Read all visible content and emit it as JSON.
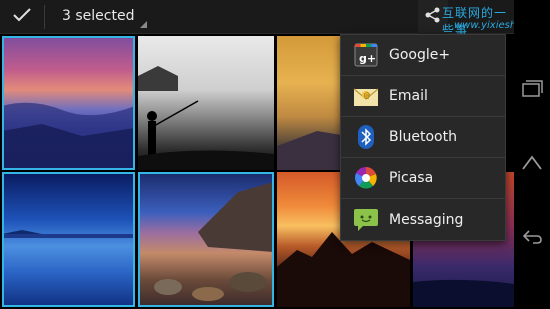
{
  "action_bar": {
    "selection_label": "3 selected",
    "done_icon": "checkmark-icon",
    "share_icon": "share-icon"
  },
  "watermark": {
    "site_name": "互联网的一些事",
    "url": "www.yixieshi.com"
  },
  "share_menu": {
    "items": [
      {
        "label": "Google+",
        "icon": "google-plus-icon"
      },
      {
        "label": "Email",
        "icon": "email-icon"
      },
      {
        "label": "Bluetooth",
        "icon": "bluetooth-icon"
      },
      {
        "label": "Picasa",
        "icon": "picasa-icon"
      },
      {
        "label": "Messaging",
        "icon": "messaging-icon"
      }
    ]
  },
  "gallery": {
    "photos": [
      {
        "subject": "purple sunset over rocky shore",
        "selected": true
      },
      {
        "subject": "fisherman silhouette on beach",
        "selected": false
      },
      {
        "subject": "desert dunes at dusk",
        "selected": false
      },
      {
        "subject": "calm blue lake",
        "selected": true
      },
      {
        "subject": "rocky coastline at twilight",
        "selected": true
      },
      {
        "subject": "orange sunset over mountains",
        "selected": false
      },
      {
        "subject": "red sky over shoreline",
        "selected": false
      }
    ]
  },
  "nav_bar": {
    "items": [
      "recent-apps-icon",
      "home-icon",
      "back-icon"
    ]
  },
  "colors": {
    "selection_accent": "#33b5e5",
    "menu_background": "#282828",
    "action_bar_background": "#1a1a1a"
  }
}
